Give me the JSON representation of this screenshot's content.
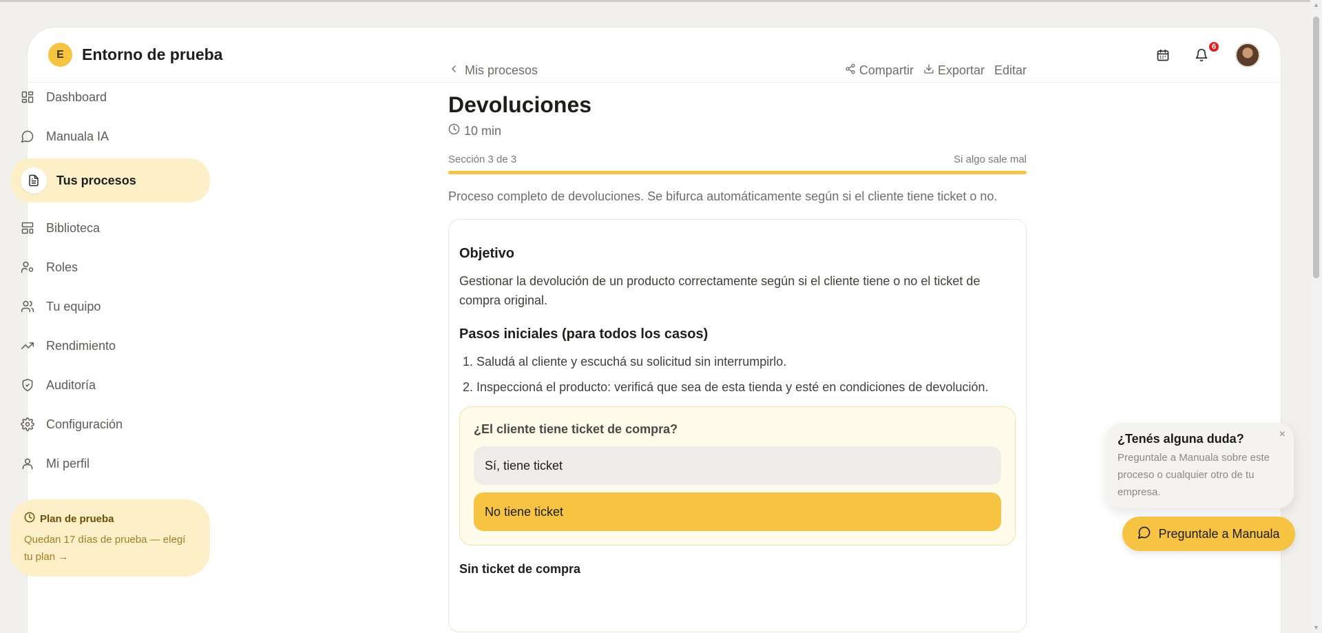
{
  "app": {
    "badge_letter": "E",
    "title": "Entorno de prueba"
  },
  "header": {
    "notifications_count": "6"
  },
  "sidebar": {
    "items": [
      {
        "label": "Dashboard",
        "icon": "dashboard-icon"
      },
      {
        "label": "Manuala IA",
        "icon": "chat-icon"
      },
      {
        "label": "Tus procesos",
        "icon": "document-icon",
        "active": true
      },
      {
        "label": "Biblioteca",
        "icon": "library-icon"
      },
      {
        "label": "Roles",
        "icon": "roles-icon"
      },
      {
        "label": "Tu equipo",
        "icon": "team-icon"
      },
      {
        "label": "Rendimiento",
        "icon": "trend-icon"
      },
      {
        "label": "Auditoría",
        "icon": "shield-icon"
      },
      {
        "label": "Configuración",
        "icon": "gear-icon"
      },
      {
        "label": "Mi perfil",
        "icon": "user-icon"
      }
    ],
    "plan": {
      "title": "Plan de prueba",
      "text": "Quedan 17 días de prueba — elegí tu plan →"
    }
  },
  "main": {
    "breadcrumb": "Mis procesos",
    "actions": {
      "share": "Compartir",
      "export": "Exportar",
      "edit": "Editar"
    },
    "title": "Devoluciones",
    "duration": "10 min",
    "progress": {
      "label": "Sección 3 de 3",
      "right_label": "Si algo sale mal",
      "fraction": 1.0
    },
    "description": "Proceso completo de devoluciones. Se bifurca automáticamente según si el cliente tiene ticket o no.",
    "card": {
      "objective_title": "Objetivo",
      "objective_text": "Gestionar la devolución de un producto correctamente según si el cliente tiene o no el ticket de compra original.",
      "steps_title": "Pasos iniciales (para todos los casos)",
      "steps": [
        "1. Saludá al cliente y escuchá su solicitud sin interrumpirlo.",
        "2. Inspeccioná el producto: verificá que sea de esta tienda y esté en condiciones de devolución."
      ],
      "decision": {
        "question": "¿El cliente tiene ticket de compra?",
        "options": [
          "Sí, tiene ticket",
          "No tiene ticket"
        ],
        "selected_index": 1
      },
      "next_section_title": "Sin ticket de compra"
    }
  },
  "help": {
    "title": "¿Tenés alguna duda?",
    "text": "Preguntale a Manuala sobre este proceso o cualquier otro de tu empresa.",
    "close": "×",
    "button": "Preguntale a Manuala"
  },
  "colors": {
    "accent": "#f6c343",
    "accent_soft": "#fdf0c9",
    "badge_red": "#e11d1d"
  }
}
